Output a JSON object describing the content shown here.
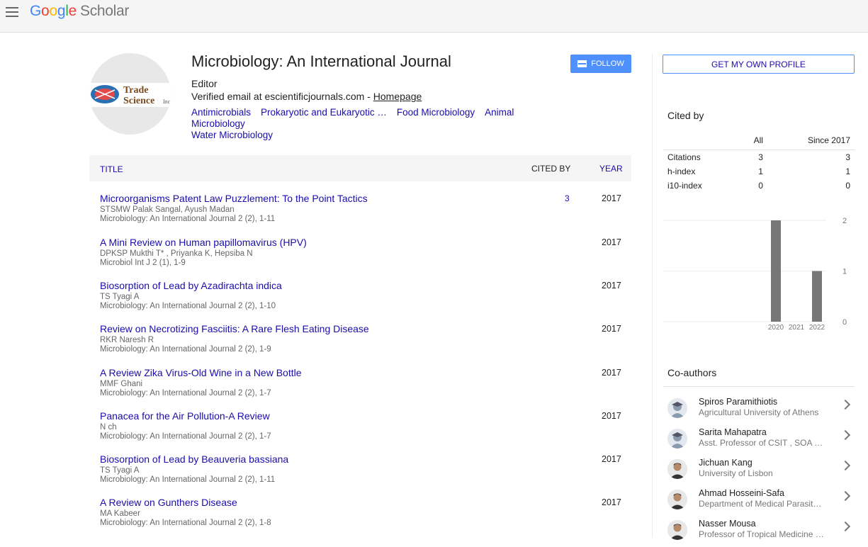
{
  "header": {
    "logo": {
      "g": "G",
      "o1": "o",
      "o2": "o",
      "g2": "g",
      "l": "l",
      "e": "e",
      "scholar": "Scholar"
    }
  },
  "profile": {
    "name": "Microbiology: An International Journal",
    "affiliation": "Editor",
    "email_text": "Verified email at escientificjournals.com - ",
    "homepage_label": "Homepage",
    "follow_label": "FOLLOW",
    "logo_text_top": "Trade",
    "logo_text_bottom": "Science",
    "logo_text_inc": "Inc",
    "interests": [
      "Antimicrobials",
      "Prokaryotic and Eukaryotic …",
      "Food Microbiology",
      "Animal Microbiology",
      "Water Microbiology"
    ]
  },
  "table": {
    "headers": {
      "title": "TITLE",
      "cited_by": "CITED BY",
      "year": "YEAR"
    },
    "articles": [
      {
        "title": "Microorganisms Patent Law Puzzlement: To the Point Tactics",
        "authors": "STSMW Palak Sangal, Ayush Madan",
        "venue": "Microbiology: An International Journal 2 (2), 1-11",
        "cited": "3",
        "year": "2017"
      },
      {
        "title": "A Mini Review on Human papillomavirus (HPV)",
        "authors": "DPKSP Mukthi T* , Priyanka K, Hepsiba N",
        "venue": "Microbiol Int J 2 (1), 1-9",
        "cited": "",
        "year": "2017"
      },
      {
        "title": "Biosorption of Lead by Azadirachta indica",
        "authors": "TS Tyagi A",
        "venue": "Microbiology: An International Journal 2 (2), 1-10",
        "cited": "",
        "year": "2017"
      },
      {
        "title": "Review on Necrotizing Fasciitis: A Rare Flesh Eating Disease",
        "authors": "RKR Naresh R",
        "venue": "Microbiology: An International Journal 2 (2), 1-9",
        "cited": "",
        "year": "2017"
      },
      {
        "title": "A Review Zika Virus-Old Wine in a New Bottle",
        "authors": "MMF Ghani",
        "venue": "Microbiology: An International Journal 2 (2), 1-7",
        "cited": "",
        "year": "2017"
      },
      {
        "title": "Panacea for the Air Pollution-A Review",
        "authors": "N ch",
        "venue": "Microbiology: An International Journal 2 (2), 1-7",
        "cited": "",
        "year": "2017"
      },
      {
        "title": "Biosorption of Lead by Beauveria bassiana",
        "authors": "TS Tyagi A",
        "venue": "Microbiology: An International Journal 2 (2), 1-11",
        "cited": "",
        "year": "2017"
      },
      {
        "title": "A Review on Gunthers Disease",
        "authors": "MA Kabeer",
        "venue": "Microbiology: An International Journal 2 (2), 1-8",
        "cited": "",
        "year": "2017"
      }
    ]
  },
  "sidebar": {
    "own_profile_label": "GET MY OWN PROFILE",
    "cited_by_title": "Cited by",
    "stats_headers": {
      "all": "All",
      "since": "Since 2017"
    },
    "stats": [
      {
        "label": "Citations",
        "all": "3",
        "since": "3"
      },
      {
        "label": "h-index",
        "all": "1",
        "since": "1"
      },
      {
        "label": "i10-index",
        "all": "0",
        "since": "0"
      }
    ],
    "coauthors_title": "Co-authors",
    "coauthors": [
      {
        "name": "Spiros Paramithiotis",
        "affil": "Agricultural University of Athens",
        "avatar": "default-avatar-icon"
      },
      {
        "name": "Sarita Mahapatra",
        "affil": "Asst. Professor of CSIT , SOA …",
        "avatar": "default-avatar-icon"
      },
      {
        "name": "Jichuan Kang",
        "affil": "University of Lisbon",
        "avatar": "photo"
      },
      {
        "name": "Ahmad Hosseini-Safa",
        "affil": "Department of Medical Parasit…",
        "avatar": "photo"
      },
      {
        "name": "Nasser Mousa",
        "affil": "Professor of Tropical Medicine …",
        "avatar": "photo"
      }
    ]
  },
  "chart_data": {
    "type": "bar",
    "categories": [
      "2020",
      "2021",
      "2022"
    ],
    "values": [
      2,
      0,
      1
    ],
    "yticks": [
      "0",
      "1",
      "2"
    ],
    "ylim": [
      0,
      2
    ],
    "bar_color": "#777777",
    "grid": true
  }
}
